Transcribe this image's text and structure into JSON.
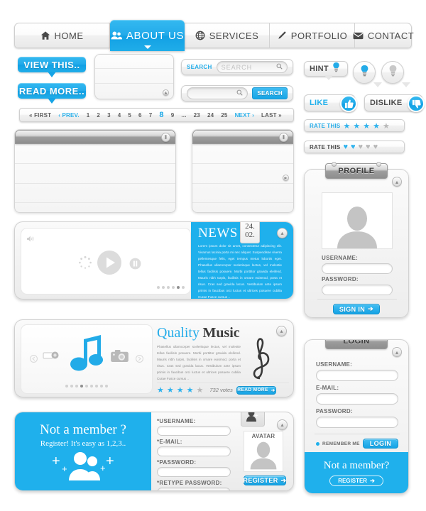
{
  "nav": {
    "items": [
      {
        "label": "HOME",
        "icon": "home-icon",
        "active": false
      },
      {
        "label": "ABOUT US",
        "icon": "users-icon",
        "active": true
      },
      {
        "label": "SERVICES",
        "icon": "globe-icon",
        "active": false
      },
      {
        "label": "PORTFOLIO",
        "icon": "pencil-icon",
        "active": false
      },
      {
        "label": "CONTACT",
        "icon": "envelope-icon",
        "active": false
      }
    ]
  },
  "buttons": {
    "view_this": "VIEW THIS..",
    "read_more": "READ MORE.."
  },
  "search": {
    "label": "SEARCH",
    "placeholder": "SEARCH",
    "value": "",
    "button_label": "SEARCH",
    "icon": "magnifier-icon"
  },
  "pagination": {
    "first": "FIRST",
    "prev": "PREV.",
    "next": "NEXT",
    "last": "LAST",
    "pages": [
      "1",
      "2",
      "3",
      "4",
      "5",
      "6",
      "7",
      "8",
      "9",
      "...",
      "23",
      "24",
      "25"
    ],
    "current": "8"
  },
  "hint": {
    "label": "HINT",
    "icon": "lightbulb-icon"
  },
  "vote": {
    "like_label": "LIKE",
    "like_icon": "thumbs-up-icon",
    "dislike_label": "DISLIKE",
    "dislike_icon": "thumbs-down-icon"
  },
  "rating_stars": {
    "label": "RATE THIS",
    "icon": "star-icon",
    "total": 5,
    "filled": 4
  },
  "rating_hearts": {
    "label": "RATE THIS",
    "icon": "heart-icon",
    "total": 5,
    "filled": 2
  },
  "profile": {
    "title": "PROFILE",
    "avatar_icon": "user-silhouette-icon",
    "username_label": "USERNAME:",
    "username_value": "",
    "password_label": "PASSWORD:",
    "password_value": "",
    "signin_label": "SIGN IN",
    "collapse_icon": "collapse-icon"
  },
  "login": {
    "title": "LOGIN",
    "username_label": "USERNAME:",
    "username_value": "",
    "email_label": "E-MAIL:",
    "email_value": "",
    "password_label": "PASSWORD:",
    "password_value": "",
    "remember_label": "REMEMBER ME",
    "login_label": "LOGIN",
    "footer_headline": "Not a member?",
    "register_label": "REGISTER",
    "collapse_icon": "collapse-icon"
  },
  "news": {
    "title": "NEWS",
    "date_day": "24.",
    "date_month": "02.",
    "body": "Lorem ipsum dolor sit amet, consectetur adipiscing elit. Vivamus lacinia porta mi nec aliquet. Suspendisse viverra pellentesque felis, eget tempus metus lobortis eget. Phasellus ullamcorper scelerisque lectus, vel molestie tellus facilisis posuere. Morbi porttitor gravida eleifend. Mauris nibh turpis, facilisis in ornare euismod, porta et risus. Cras sed gravida lacus. Vestibulum ante ipsum primis in faucibus orci luctus et ultrices posuere cubilia Curae Fusce cursus ..",
    "play_icon": "play-icon",
    "pause_icon": "pause-icon",
    "volume_icon": "volume-icon",
    "loading_icon": "spinner-icon",
    "slides": 6,
    "active_slide": 5
  },
  "music": {
    "title_accent": "Quality",
    "title_rest": "Music",
    "body": "Phasellus ullamcorper scelerisque lectus, vel molestie tellus facilisis posuere. Morbi porttitor gravida eleifend. Mauris nibh turpis, facilisis in ornare euismod, porta et risus. Cras sed gravida lacus. Vestibulum ante ipsum primis in faucibus orci luctus et ultrices posuere cubilia Curae Fusce cursus ..",
    "note_icon": "music-note-icon",
    "clef_icon": "treble-clef-icon",
    "camcorder_icon": "camcorder-icon",
    "camera_icon": "camera-icon",
    "stars_total": 5,
    "stars_filled": 4,
    "votes": "732 votes",
    "read_more_label": "READ MORE",
    "slides": 9,
    "active_slide": 4
  },
  "register": {
    "headline": "Not a member ?",
    "subline": "Register! It's easy as 1,2,3..",
    "promo_icon": "add-users-icon",
    "tab_icon": "add-user-icon",
    "fields": [
      {
        "label": "*USERNAME:",
        "value": ""
      },
      {
        "label": "*E-MAIL:",
        "value": ""
      },
      {
        "label": "*PASSWORD:",
        "value": ""
      },
      {
        "label": "*RETYPE PASSWORD:",
        "value": ""
      }
    ],
    "avatar_label": "AVATAR",
    "avatar_icon": "user-silhouette-icon",
    "register_label": "REGISTER",
    "collapse_icon": "collapse-icon"
  },
  "colors": {
    "accent": "#1fb0ec",
    "accent_dark": "#11a0e4",
    "panel": "#efefef",
    "text": "#555555"
  }
}
